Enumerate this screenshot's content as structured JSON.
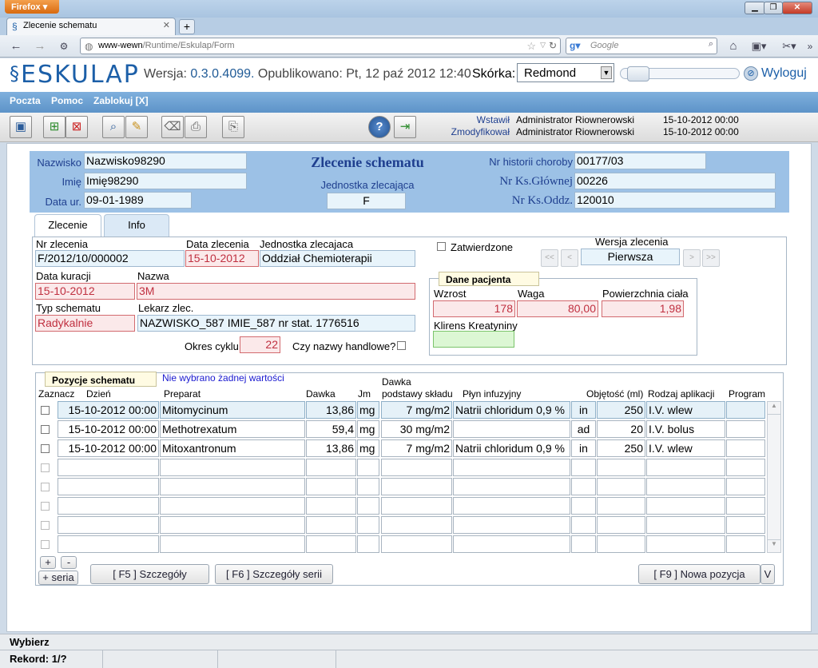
{
  "browser": {
    "menu_button": "Firefox",
    "tab_title": "Zlecenie schematu",
    "url_host": "www-wewn",
    "url_path": "/Runtime/Eskulap/Form",
    "search_placeholder": "Google"
  },
  "app": {
    "logo": "ESKULAP",
    "version_label": "Wersja:",
    "version": "0.3.0.4099.",
    "published": "Opublikowano: Pt, 12 paź 2012 12:40",
    "skin_label": "Skórka:",
    "skin_value": "Redmond",
    "logout": "Wyloguj"
  },
  "menu": [
    {
      "label": "Poczta"
    },
    {
      "label": "Pomoc"
    },
    {
      "label": "Zablokuj [X]"
    }
  ],
  "meta": {
    "inserted_label": "Wstawił",
    "inserted_by": "Administrator Riownerowski",
    "inserted_at": "15-10-2012 00:00",
    "modified_label": "Zmodyfikował",
    "modified_by": "Administrator Riownerowski",
    "modified_at": "15-10-2012 00:00"
  },
  "patient": {
    "surname_label": "Nazwisko",
    "surname": "Nazwisko98290",
    "name_label": "Imię",
    "name": "Imię98290",
    "dob_label": "Data ur.",
    "dob": "09-01-1989",
    "form_title": "Zlecenie schematu",
    "unit_label": "Jednostka zlecająca",
    "unit": "F",
    "history_label": "Nr historii choroby",
    "history": "00177/03",
    "main_book_label": "Nr Ks.Głównej",
    "main_book": "00226",
    "ward_book_label": "Nr Ks.Oddz.",
    "ward_book": "120010"
  },
  "tabs": [
    {
      "label": "Zlecenie"
    },
    {
      "label": "Info"
    }
  ],
  "order": {
    "nr_label": "Nr zlecenia",
    "nr": "F/2012/10/000002",
    "date_label": "Data zlecenia",
    "date": "15-10-2012",
    "unit_label": "Jednostka zlecajaca",
    "unit": "Oddział Chemioterapii",
    "approved_label": "Zatwierdzone",
    "version_label": "Wersja zlecenia",
    "version": "Pierwsza",
    "nav_first": "<<",
    "nav_prev": "<",
    "nav_next": ">",
    "nav_last": ">>",
    "treat_date_label": "Data kuracji",
    "treat_date": "15-10-2012",
    "name_label": "Nazwa",
    "name": "3M",
    "schema_type_label": "Typ schematu",
    "schema_type": "Radykalnie",
    "doctor_label": "Lekarz zlec.",
    "doctor": "NAZWISKO_587 IMIE_587 nr stat. 1776516",
    "cycle_label": "Okres cyklu",
    "cycle": "22",
    "trade_names_label": "Czy nazwy handlowe?"
  },
  "patient_data": {
    "title": "Dane pacjenta",
    "height_label": "Wzrost",
    "height": "178",
    "weight_label": "Waga",
    "weight": "80,00",
    "bsa_label": "Powierzchnia ciała",
    "bsa": "1,98",
    "clearance_label": "Klirens Kreatyniny",
    "clearance": ""
  },
  "positions": {
    "title": "Pozycje schematu",
    "no_value": "Nie wybrano żadnej wartości",
    "headers": {
      "select": "Zaznacz",
      "day": "Dzień",
      "drug": "Preparat",
      "dose": "Dawka",
      "unit": "Jm",
      "base_dose_1": "Dawka",
      "base_dose_2": "podstawy składu",
      "fluid": "Płyn infuzyjny",
      "volume": "Objętość (ml)",
      "route": "Rodzaj aplikacji",
      "program": "Program"
    },
    "rows": [
      {
        "day": "15-10-2012 00:00",
        "drug": "Mitomycinum",
        "dose": "13,86",
        "unit": "mg",
        "base": "7 mg/m2",
        "fluid": "Natrii chloridum 0,9 %",
        "mode": "in",
        "volume": "250",
        "route": "I.V. wlew",
        "program": ""
      },
      {
        "day": "15-10-2012 00:00",
        "drug": "Methotrexatum",
        "dose": "59,4",
        "unit": "mg",
        "base": "30 mg/m2",
        "fluid": "",
        "mode": "ad",
        "volume": "20",
        "route": "I.V. bolus",
        "program": ""
      },
      {
        "day": "15-10-2012 00:00",
        "drug": "Mitoxantronum",
        "dose": "13,86",
        "unit": "mg",
        "base": "7 mg/m2",
        "fluid": "Natrii chloridum 0,9 %",
        "mode": "in",
        "volume": "250",
        "route": "I.V. wlew",
        "program": ""
      }
    ],
    "add": "+",
    "remove": "-",
    "add_series": "+ seria",
    "btn_details": "[ F5 ] Szczegóły",
    "btn_series_details": "[ F6 ] Szczegóły serii",
    "btn_new": "[ F9 ] Nowa pozycja",
    "btn_more": "V"
  },
  "status": {
    "action": "Wybierz",
    "record": "Rekord: 1/?"
  }
}
